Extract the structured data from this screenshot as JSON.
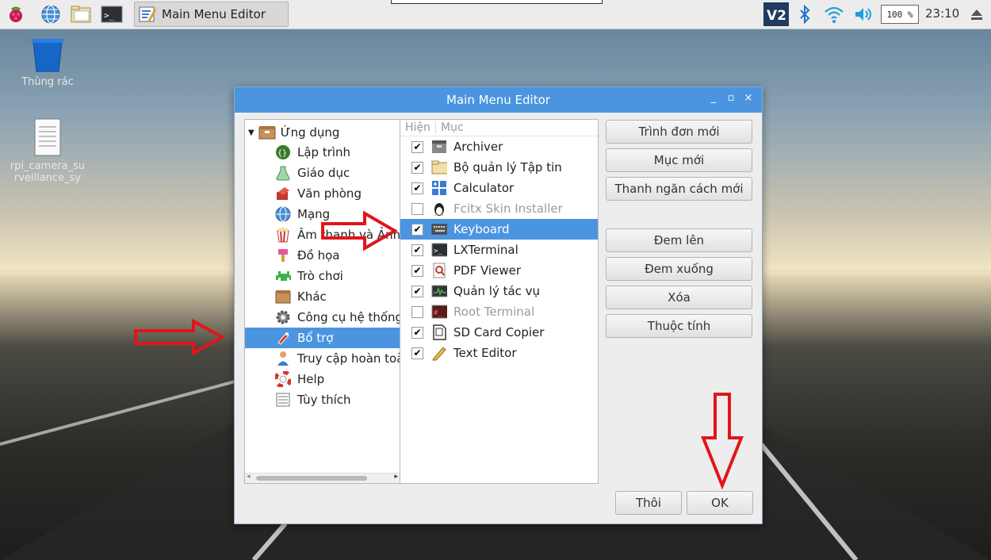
{
  "taskbar": {
    "window_button": "Main Menu Editor",
    "clock": "23:10",
    "battery": "100 %"
  },
  "desktop": {
    "trash_label": "Thùng rác",
    "file_label_line1": "rpi_camera_su",
    "file_label_line2": "rveillance_sy"
  },
  "window": {
    "title": "Main Menu Editor",
    "controls": {
      "minimize": "_",
      "maximize": "▫",
      "close": "×"
    }
  },
  "tree": {
    "root": "Ứng dụng",
    "items": [
      {
        "label": "Lập trình",
        "icon": "code-icon"
      },
      {
        "label": "Giáo dục",
        "icon": "flask-icon"
      },
      {
        "label": "Văn phòng",
        "icon": "office-icon"
      },
      {
        "label": "Mạng",
        "icon": "globe-icon"
      },
      {
        "label": "Âm thanh và Ảnh",
        "icon": "popcorn-icon"
      },
      {
        "label": "Đồ họa",
        "icon": "brush-icon"
      },
      {
        "label": "Trò chơi",
        "icon": "game-icon"
      },
      {
        "label": "Khác",
        "icon": "box-icon"
      },
      {
        "label": "Công cụ hệ thống",
        "icon": "gear-icon"
      },
      {
        "label": "Bổ trợ",
        "icon": "accessory-icon"
      },
      {
        "label": "Truy cập hoàn toàn",
        "icon": "person-icon"
      },
      {
        "label": "Help",
        "icon": "lifebuoy-icon"
      },
      {
        "label": "Tùy thích",
        "icon": "preferences-icon"
      }
    ],
    "selected": "Bổ trợ"
  },
  "list": {
    "col_show": "Hiện",
    "col_item": "Mục",
    "rows": [
      {
        "label": "Archiver",
        "checked": true,
        "icon": "archive-icon"
      },
      {
        "label": "Bộ quản lý Tập tin",
        "checked": true,
        "icon": "folder-icon"
      },
      {
        "label": "Calculator",
        "checked": true,
        "icon": "calculator-icon"
      },
      {
        "label": "Fcitx Skin Installer",
        "checked": false,
        "icon": "tux-icon"
      },
      {
        "label": "Keyboard",
        "checked": true,
        "icon": "keyboard-icon"
      },
      {
        "label": "LXTerminal",
        "checked": true,
        "icon": "terminal-icon"
      },
      {
        "label": "PDF Viewer",
        "checked": true,
        "icon": "pdf-icon"
      },
      {
        "label": "Quản lý tác vụ",
        "checked": true,
        "icon": "task-manager-icon"
      },
      {
        "label": "Root Terminal",
        "checked": false,
        "icon": "root-terminal-icon"
      },
      {
        "label": "SD Card Copier",
        "checked": true,
        "icon": "sdcard-icon"
      },
      {
        "label": "Text Editor",
        "checked": true,
        "icon": "pencil-icon"
      }
    ],
    "selected": "Keyboard"
  },
  "buttons": {
    "new_menu": "Trình đơn mới",
    "new_item": "Mục mới",
    "new_separator": "Thanh ngăn cách mới",
    "move_up": "Đem lên",
    "move_down": "Đem xuống",
    "delete": "Xóa",
    "properties": "Thuộc tính",
    "cancel": "Thôi",
    "ok": "OK"
  },
  "colors": {
    "selection": "#4b95e0",
    "titlebar": "#4b95e0",
    "annotation_arrow": "#e0161b"
  }
}
